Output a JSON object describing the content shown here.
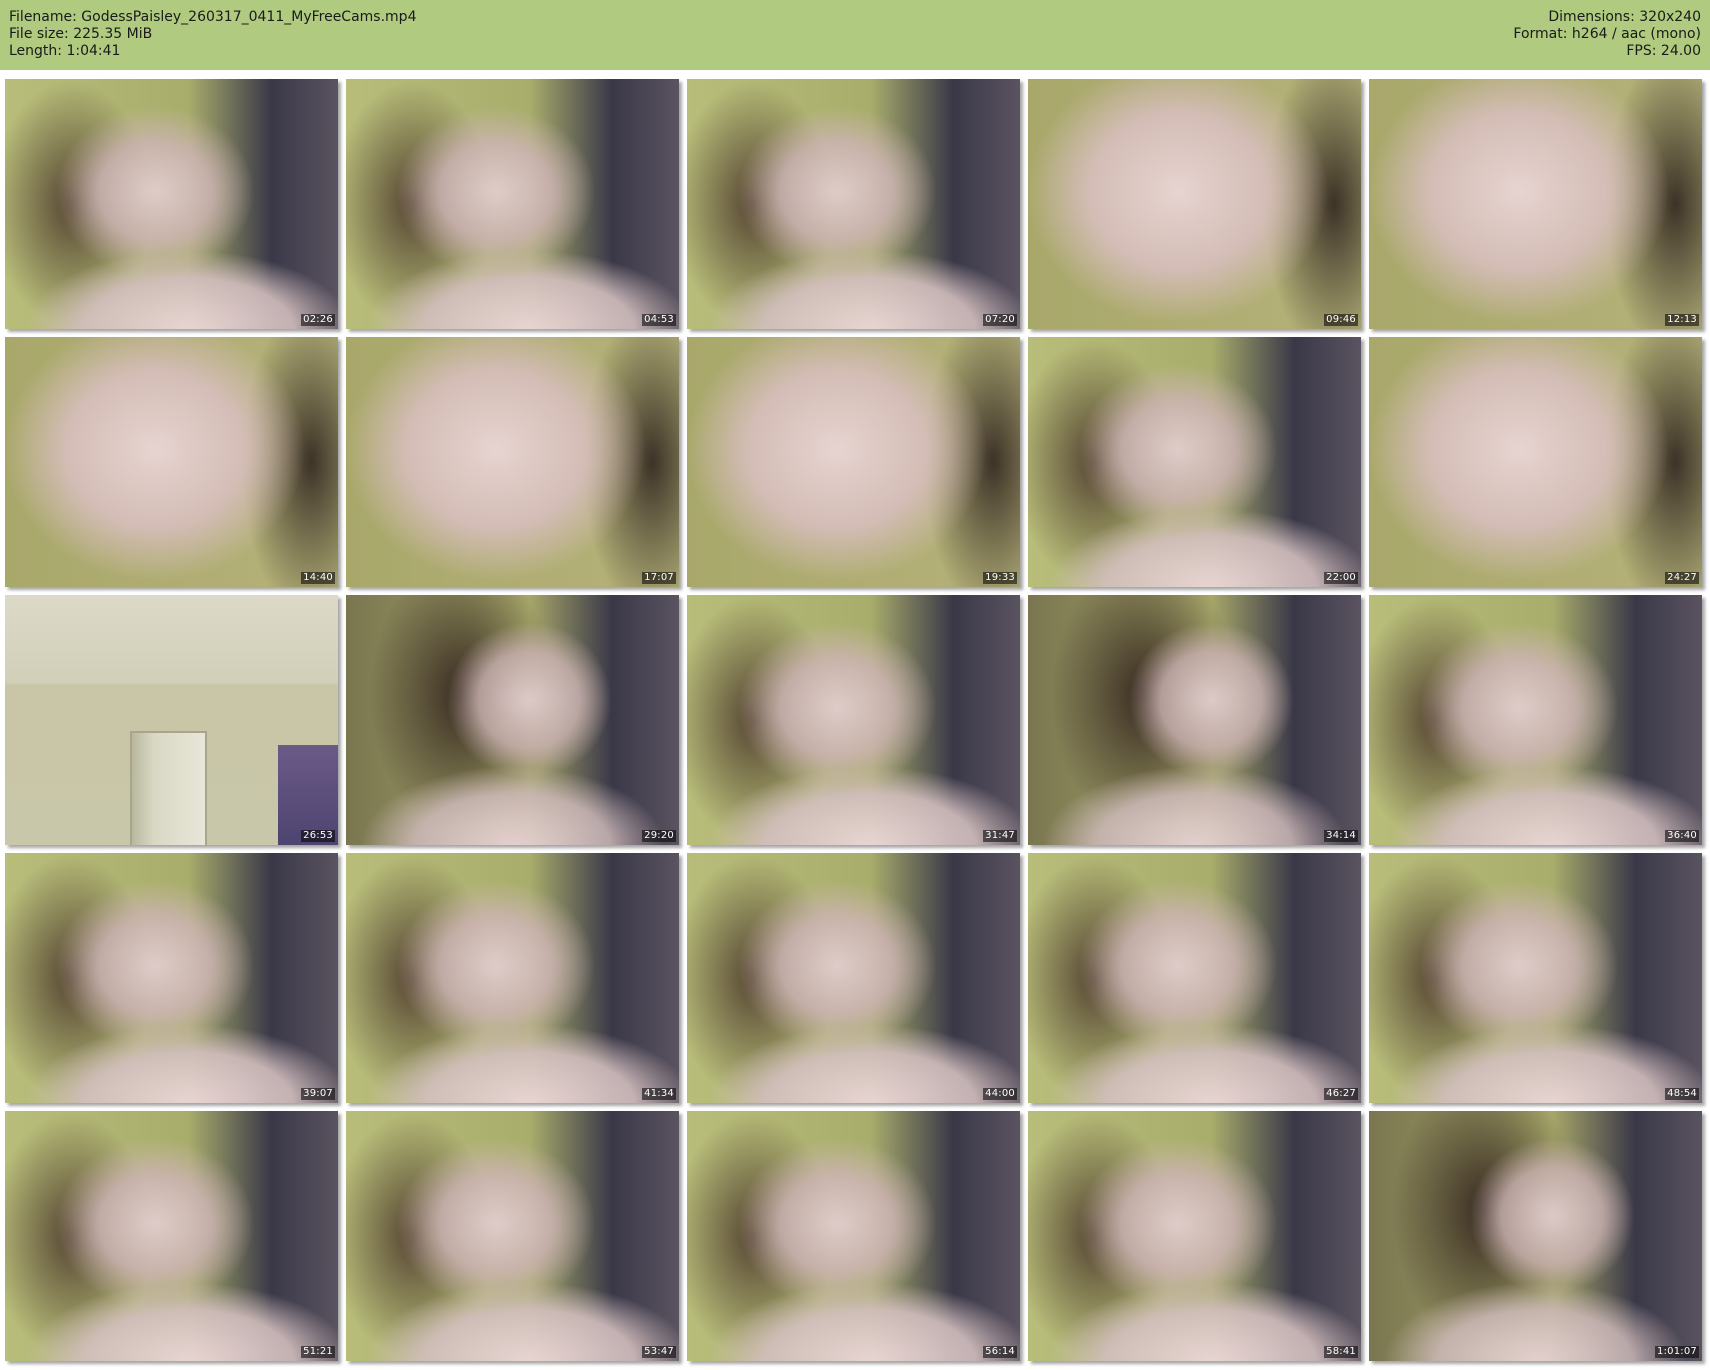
{
  "header": {
    "filename": "Filename: GodessPaisley_260317_0411_MyFreeCams.mp4",
    "filesize": "File size: 225.35 MiB",
    "length": "Length: 1:04:41",
    "dimensions": "Dimensions: 320x240",
    "format": "Format: h264 / aac (mono)",
    "fps": "FPS: 24.00"
  },
  "colors": {
    "header_bg": "#b0cb80",
    "page_bg": "#ffffff"
  },
  "rows": [
    {
      "thumbs": [
        {
          "time": "02:26",
          "variant": "default"
        },
        {
          "time": "04:53",
          "variant": "default"
        },
        {
          "time": "07:20",
          "variant": "default"
        },
        {
          "time": "09:46",
          "variant": "close"
        },
        {
          "time": "12:13",
          "variant": "close"
        }
      ]
    },
    {
      "thumbs": [
        {
          "time": "14:40",
          "variant": "close"
        },
        {
          "time": "17:07",
          "variant": "close"
        },
        {
          "time": "19:33",
          "variant": "close"
        },
        {
          "time": "22:00",
          "variant": "default"
        },
        {
          "time": "24:27",
          "variant": "close"
        }
      ]
    },
    {
      "thumbs": [
        {
          "time": "26:53",
          "variant": "room"
        },
        {
          "time": "29:20",
          "variant": "hair"
        },
        {
          "time": "31:47",
          "variant": "default"
        },
        {
          "time": "34:14",
          "variant": "hair"
        },
        {
          "time": "36:40",
          "variant": "default"
        }
      ]
    },
    {
      "thumbs": [
        {
          "time": "39:07",
          "variant": "default"
        },
        {
          "time": "41:34",
          "variant": "default"
        },
        {
          "time": "44:00",
          "variant": "default"
        },
        {
          "time": "46:27",
          "variant": "default"
        },
        {
          "time": "48:54",
          "variant": "default"
        }
      ]
    },
    {
      "thumbs": [
        {
          "time": "51:21",
          "variant": "default"
        },
        {
          "time": "53:47",
          "variant": "default"
        },
        {
          "time": "56:14",
          "variant": "default"
        },
        {
          "time": "58:41",
          "variant": "default"
        },
        {
          "time": "1:01:07",
          "variant": "hair"
        }
      ]
    }
  ]
}
